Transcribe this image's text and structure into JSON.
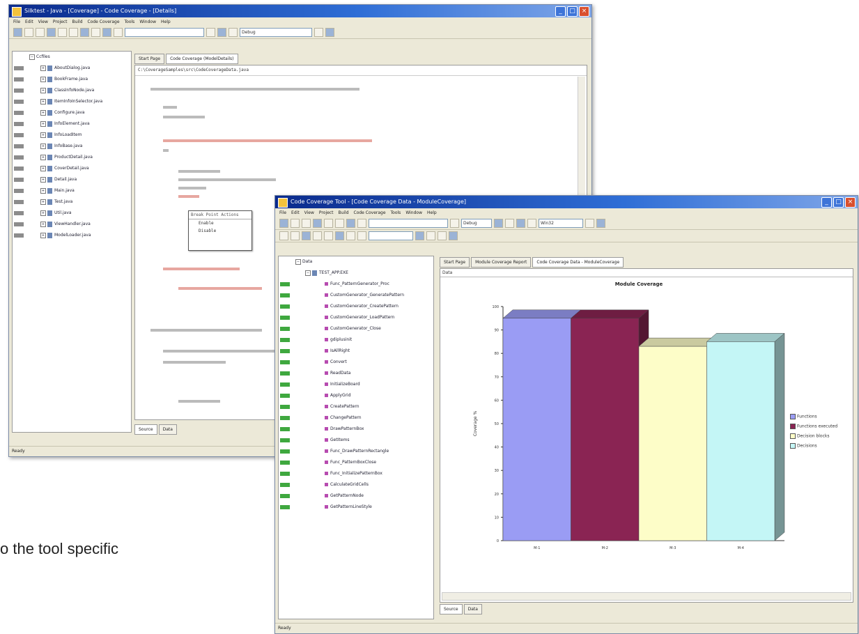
{
  "back_window": {
    "title": "Silktest - Java - [Coverage] - Code Coverage - [Details]",
    "menu": [
      "File",
      "Edit",
      "View",
      "Project",
      "Build",
      "Code Coverage",
      "Tools",
      "Window",
      "Help"
    ],
    "search_combo": "",
    "config_combo": "Debug",
    "tree_root": "Ccfiles",
    "tree_items": [
      "AboutDialog.java",
      "BookFrame.java",
      "ClassInfoNode.java",
      "ItemInfoInSelector.java",
      "Configure.java",
      "InfoElement.java",
      "InfoLoadItem",
      "InfoBase.java",
      "ProductDetail.java",
      "CoverDetail.java",
      "Detail.java",
      "Main.java",
      "Test.java",
      "Util.java",
      "ViewHandler.java",
      "ModelLoader.java"
    ],
    "editor_tabs": [
      "Start Page",
      "Code Coverage (ModelDetails)"
    ],
    "editor_path": "C:\\CoverageSamples\\src\\CodeCoverageData.java",
    "bottom_tabs": [
      "Source",
      "Data"
    ],
    "status": "Ready",
    "popup_items": [
      "Break Point Actions",
      "Enable",
      "Disable"
    ]
  },
  "front_window": {
    "title": "Code Coverage Tool - [Code Coverage Data - ModuleCoverage]",
    "menu": [
      "File",
      "Edit",
      "View",
      "Project",
      "Build",
      "Code Coverage",
      "Tools",
      "Window",
      "Help"
    ],
    "config_combo": "Debug",
    "platform_combo": "Win32",
    "tabs": [
      "Start Page",
      "Module Coverage Report",
      "Code Coverage Data - ModuleCoverage"
    ],
    "pane_label": "Data",
    "tree_root": "Data",
    "tree_module": "TEST_APP.EXE",
    "tree_items": [
      "Func_PatternGenerator_Proc",
      "CustomGenerator_GeneratePattern",
      "CustomGenerator_CreatePattern",
      "CustomGenerator_LoadPattern",
      "CustomGenerator_Close",
      "gdiplusinit",
      "IsAllRight",
      "Convert",
      "ReadData",
      "InitializeBoard",
      "ApplyGrid",
      "CreatePattern",
      "ChangePattern",
      "DrawPatternBox",
      "GetItems",
      "Func_DrawPatternRectangle",
      "Func_PatternBoxClose",
      "Func_InitializePatternBox",
      "CalculateGridCells",
      "GetPatternNode",
      "GetPatternLineStyle"
    ],
    "bottom_tabs": [
      "Source",
      "Data"
    ],
    "status": "Ready"
  },
  "chart_data": {
    "type": "bar",
    "title": "Module Coverage",
    "ylabel": "Coverage %",
    "xlabel": "",
    "categories": [
      "M-1",
      "M-2",
      "M-3",
      "M-4"
    ],
    "values": [
      95,
      95,
      83,
      85
    ],
    "ylim": [
      0,
      100
    ],
    "yticks": [
      0,
      10,
      20,
      30,
      40,
      50,
      60,
      70,
      80,
      90,
      100
    ],
    "colors": [
      "#9a9cf4",
      "#8a2453",
      "#fdfdc8",
      "#c4f6f6"
    ],
    "legend_position": "right",
    "legend": [
      "Functions",
      "Functions executed",
      "Decision blocks",
      "Decisions"
    ],
    "grid": false
  },
  "caption": "o the tool specific"
}
